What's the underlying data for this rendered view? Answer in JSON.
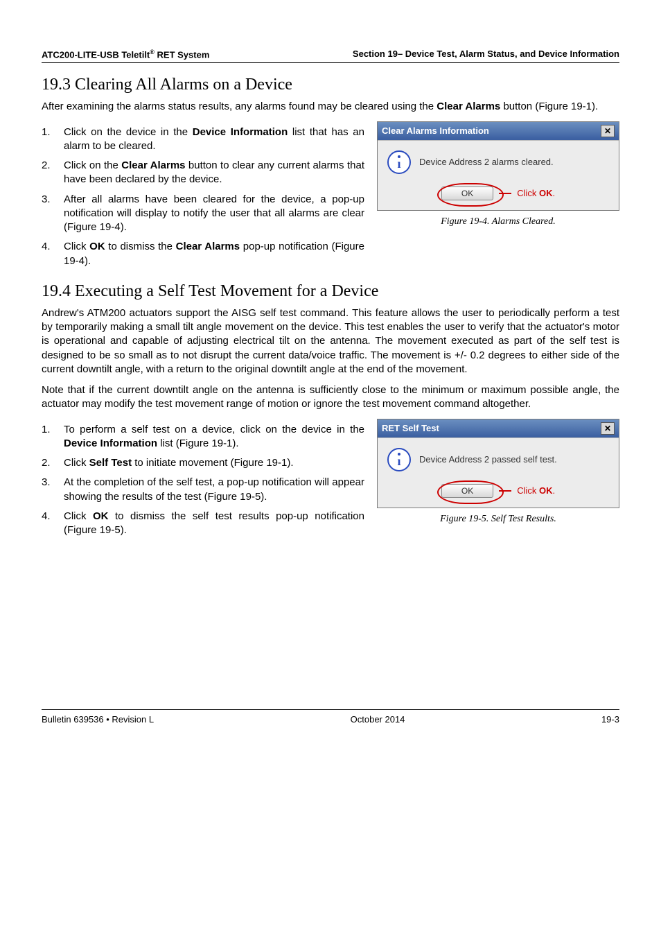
{
  "header": {
    "left_prefix": "ATC200-LITE-USB Teletilt",
    "left_suffix": " RET System",
    "reg_mark": "®",
    "right": "Section 19– Device Test, Alarm Status, and Device Information"
  },
  "section_19_3": {
    "heading": "19.3 Clearing All Alarms on a Device",
    "intro_a": "After examining the alarms status results, any alarms found may be cleared using the ",
    "intro_b": "Clear Alarms",
    "intro_c": " button (Figure 19-1).",
    "items": [
      {
        "num": "1.",
        "pre": "Click on the device in the ",
        "bold": "Device Information",
        "post": " list that has an alarm to be cleared."
      },
      {
        "num": "2.",
        "pre": "Click on the ",
        "bold": "Clear Alarms",
        "post": " button to clear any current alarms that have been declared by the device."
      },
      {
        "num": "3.",
        "plain": "After all alarms have been cleared for the device, a pop-up notification will display to notify the user that all alarms are clear (Figure 19-4)."
      },
      {
        "num": "4.",
        "pre": "Click ",
        "bold": "OK",
        "mid": " to dismiss the ",
        "bold2": "Clear Alarms",
        "post": " pop-up notification (Figure 19-4)."
      }
    ],
    "dialog": {
      "title": "Clear Alarms Information",
      "message": "Device Address 2 alarms cleared.",
      "ok": "OK",
      "callout_pre": "Click ",
      "callout_bold": "OK",
      "callout_post": "."
    },
    "caption": "Figure 19-4.  Alarms Cleared."
  },
  "section_19_4": {
    "heading": "19.4 Executing a Self Test Movement for a Device",
    "para1": "Andrew's ATM200 actuators support the AISG self test command. This feature allows the user to periodically perform a test by temporarily making a small tilt angle movement on the device. This test enables the user to verify that the actuator's motor is operational and capable of adjusting electrical tilt on the antenna. The movement executed as part of the self test is designed to be so small as to not disrupt the current data/voice traffic. The movement is +/- 0.2 degrees to either side of the current downtilt angle, with a return to the original downtilt angle at the end of the movement.",
    "para2": "Note that if the current downtilt angle on the antenna is sufficiently close to the minimum or maximum possible angle, the actuator may modify the test movement range of motion or ignore the test movement command altogether.",
    "items": [
      {
        "num": "1.",
        "pre": "To perform a self test on a device, click on the device in the ",
        "bold": "Device Information",
        "post": " list (Figure 19-1)."
      },
      {
        "num": "2.",
        "pre": "Click ",
        "bold": "Self Test",
        "post": " to initiate movement (Figure 19-1)."
      },
      {
        "num": "3.",
        "plain": "At the completion of the self test, a pop-up notification will appear showing the results of the test (Figure 19-5)."
      },
      {
        "num": "4.",
        "pre": "Click ",
        "bold": "OK",
        "post": " to dismiss the self test results pop-up notification (Figure 19-5)."
      }
    ],
    "dialog": {
      "title": "RET Self Test",
      "message": "Device Address 2 passed self test.",
      "ok": "OK",
      "callout_pre": "Click ",
      "callout_bold": "OK",
      "callout_post": "."
    },
    "caption": "Figure 19-5. Self Test Results."
  },
  "footer": {
    "left": "Bulletin 639536  •  Revision L",
    "center": "October 2014",
    "right": "19-3"
  },
  "icons": {
    "close": "✕",
    "info_body": "ı"
  }
}
